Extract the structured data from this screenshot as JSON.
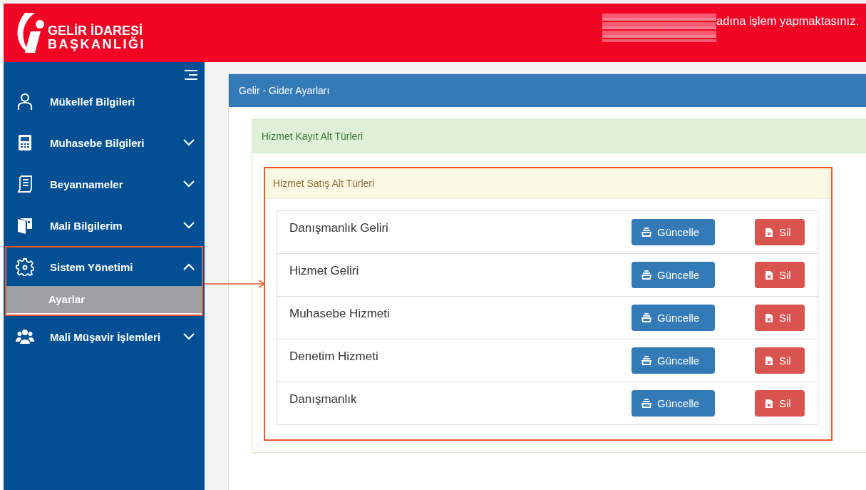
{
  "header": {
    "logo_lines": [
      "GELİR İDARESİ",
      "BAŞKANLIĞI"
    ],
    "user_notice": "adına işlem yapmaktasınız."
  },
  "sidebar": {
    "items": [
      {
        "label": "Mükellef Bilgileri",
        "highlighted": false
      },
      {
        "label": "Muhasebe Bilgileri",
        "expanded": false,
        "highlighted": false
      },
      {
        "label": "Beyannameler",
        "expanded": false,
        "highlighted": false
      },
      {
        "label": "Mali Bilgilerim",
        "expanded": false,
        "highlighted": false
      },
      {
        "label": "Sistem Yönetimi",
        "expanded": true,
        "highlighted": true,
        "children": [
          {
            "label": "Ayarlar",
            "selected": true
          }
        ]
      },
      {
        "label": "Mali Müşavir İşlemleri",
        "expanded": false,
        "highlighted": false
      }
    ]
  },
  "panel": {
    "title": "Gelir - Gider Ayarları",
    "subpanel": {
      "title": "Hizmet Kayıt Alt Türleri",
      "section": {
        "title": "Hizmet Satış Alt Türleri",
        "highlighted": true,
        "rows": [
          {
            "name": "Danışmanlık Geliri",
            "update": "Güncelle",
            "delete": "Sil"
          },
          {
            "name": "Hizmet Geliri",
            "update": "Güncelle",
            "delete": "Sil"
          },
          {
            "name": "Muhasebe Hizmeti",
            "update": "Güncelle",
            "delete": "Sil"
          },
          {
            "name": "Denetim Hizmeti",
            "update": "Güncelle",
            "delete": "Sil"
          },
          {
            "name": "Danışmanlık",
            "update": "Güncelle",
            "delete": "Sil"
          }
        ]
      }
    }
  }
}
